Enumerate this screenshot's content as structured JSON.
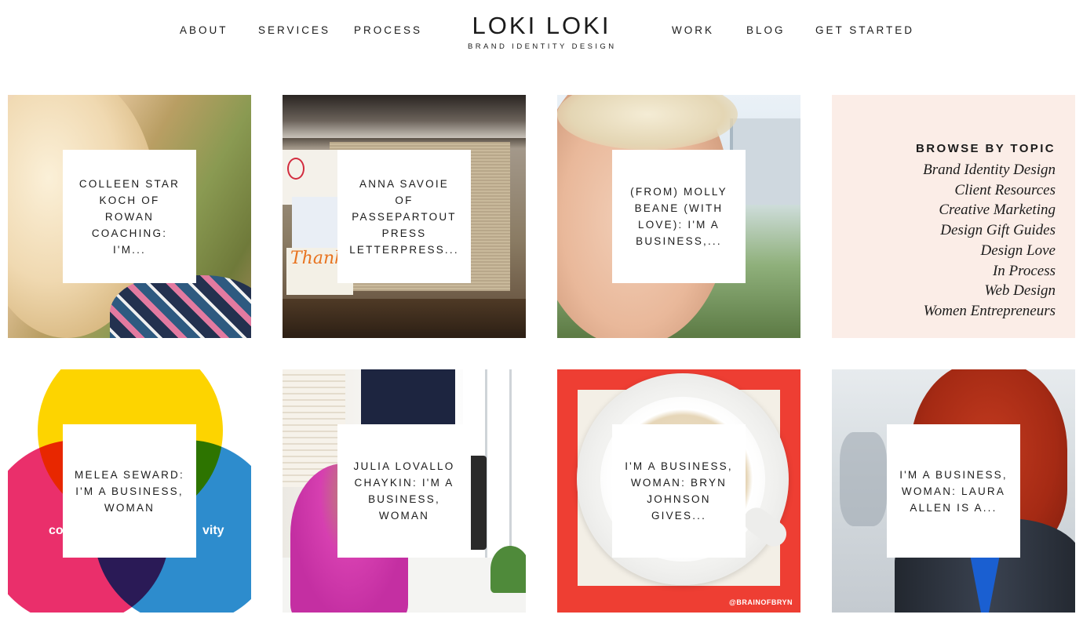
{
  "header": {
    "nav_left": [
      "ABOUT",
      "SERVICES",
      "PROCESS"
    ],
    "nav_right": [
      "WORK",
      "BLOG",
      "GET STARTED"
    ],
    "logo_name": "LOKI LOKI",
    "logo_tagline": "BRAND IDENTITY DESIGN"
  },
  "posts": [
    {
      "caption": "COLLEEN STAR KOCH OF ROWAN COACHING: I'M..."
    },
    {
      "caption": "ANNA SAVOIE OF PASSEPARTOUT PRESS LETTERPRESS..."
    },
    {
      "caption": "(FROM) MOLLY BEANE (WITH LOVE): I'M A BUSINESS,..."
    },
    {
      "caption": "MELEA SEWARD: I'M A BUSINESS, WOMAN"
    },
    {
      "caption": "JULIA LOVALLO CHAYKIN: I'M A BUSINESS, WOMAN"
    },
    {
      "caption": "I'M A BUSINESS, WOMAN: BRYN JOHNSON GIVES..."
    },
    {
      "caption": "I'M A BUSINESS, WOMAN: LAURA ALLEN IS A..."
    }
  ],
  "browse": {
    "heading": "BROWSE BY TOPIC",
    "topics": [
      "Brand Identity Design",
      "Client Resources",
      "Creative Marketing",
      "Design Gift Guides",
      "Design Love",
      "In Process",
      "Web Design",
      "Women Entrepreneurs"
    ]
  },
  "image_text": {
    "venn_left": "co",
    "venn_right": "vity",
    "thank_you": "Thank you!",
    "coffee_credit": "@BRAINOFBRYN"
  },
  "colors": {
    "browse_bg": "#fbede7",
    "venn_yellow": "#fdd400",
    "venn_pink": "#ea2f6b",
    "venn_blue": "#2d8ccd",
    "coffee_red": "#ee3e33"
  }
}
